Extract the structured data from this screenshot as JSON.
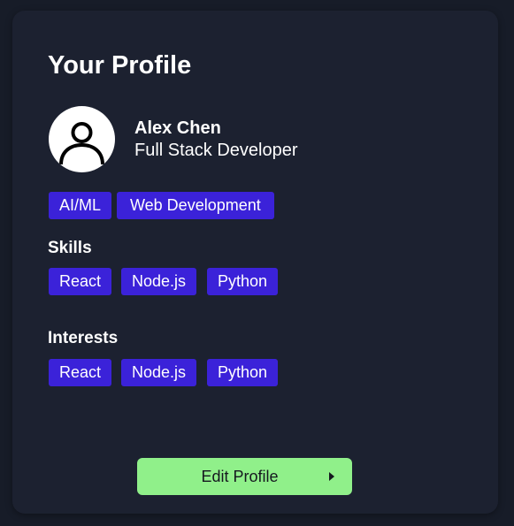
{
  "profile": {
    "title": "Your Profile",
    "name": "Alex Chen",
    "role": "Full Stack Developer",
    "avatar_icon": "user-avatar-icon",
    "categories": [
      "AI/ML",
      "Web Development"
    ]
  },
  "skills": {
    "heading": "Skills",
    "items": [
      "React",
      "Node.js",
      "Python"
    ]
  },
  "interests": {
    "heading": "Interests",
    "items": [
      "React",
      "Node.js",
      "Python"
    ]
  },
  "actions": {
    "edit_label": "Edit Profile",
    "edit_icon": "caret-right-icon"
  },
  "colors": {
    "background": "#171c28",
    "card": "#1c2130",
    "tag": "#3b22d9",
    "button": "#90f08a"
  }
}
